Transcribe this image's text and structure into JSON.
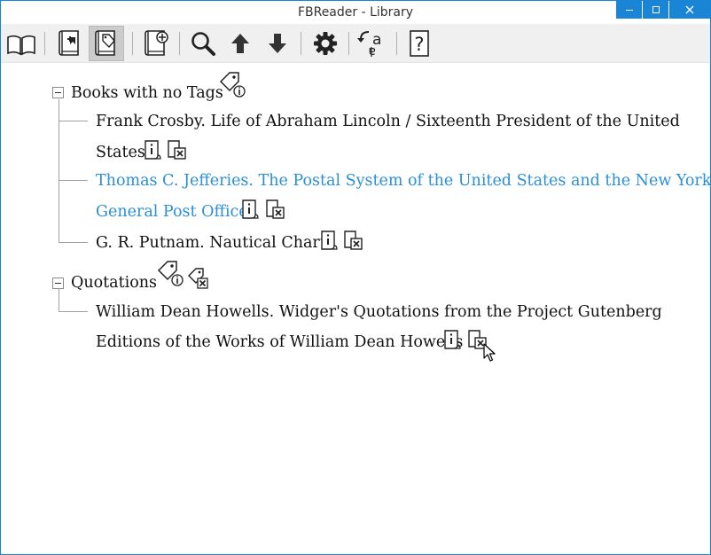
{
  "window": {
    "title": "FBReader - Library",
    "controls": [
      "minimize",
      "maximize",
      "close"
    ]
  },
  "toolbar": {
    "buttons": [
      {
        "name": "library-icon",
        "active": false
      },
      {
        "name": "add-book-icon",
        "active": false
      },
      {
        "name": "tag-book-icon",
        "active": true
      },
      {
        "name": "network-library-icon",
        "active": false
      },
      {
        "name": "search-icon",
        "active": false
      },
      {
        "name": "arrow-up-icon",
        "active": false
      },
      {
        "name": "arrow-down-icon",
        "active": false
      },
      {
        "name": "settings-gear-icon",
        "active": false
      },
      {
        "name": "language-icon",
        "active": false
      },
      {
        "name": "help-icon",
        "active": false
      }
    ],
    "accent": "#1a85d4"
  },
  "tree": {
    "groups": [
      {
        "label": "Books with no Tags",
        "books": [
          {
            "line1": "Frank Crosby. Life of Abraham Lincoln / Sixteenth President of the United",
            "line2": "States",
            "selected": false
          },
          {
            "line1": "Thomas C. Jefferies. The Postal System of the United States and the New York",
            "line2": "General Post Office",
            "selected": true
          },
          {
            "line1": "G. R. Putnam. Nautical Charts",
            "line2": "",
            "selected": false
          }
        ]
      },
      {
        "label": "Quotations",
        "books": [
          {
            "line1": "William Dean Howells. Widger's Quotations from the Project Gutenberg",
            "line2": "Editions of the Works of William Dean Howells",
            "selected": false
          }
        ]
      }
    ],
    "link_color": "#2a8fd8"
  }
}
